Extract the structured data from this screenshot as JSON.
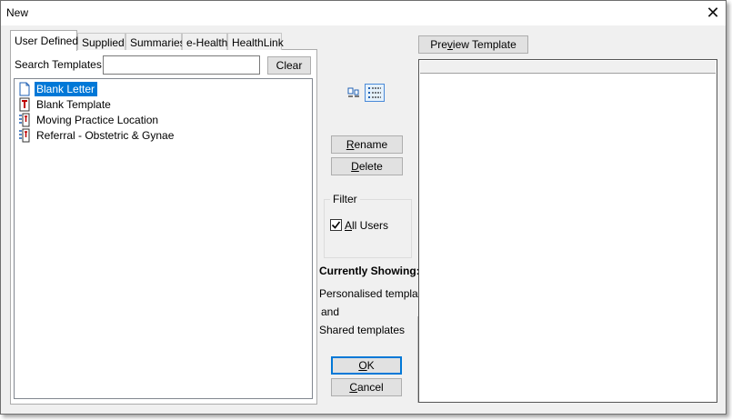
{
  "window": {
    "title": "New",
    "close_glyph": "✕"
  },
  "tabs": [
    {
      "label": "User Defined",
      "active": true
    },
    {
      "label": "Supplied"
    },
    {
      "label": "Summaries"
    },
    {
      "label": "e-Health"
    },
    {
      "label": "HealthLink"
    }
  ],
  "search": {
    "label": "Search Templates:",
    "value": "",
    "placeholder": "",
    "clear_label": "Clear"
  },
  "templates": [
    {
      "label": "Blank Letter",
      "icon": "document-icon",
      "selected": true
    },
    {
      "label": "Blank Template",
      "icon": "template-icon"
    },
    {
      "label": "Moving Practice Location",
      "icon": "shared-template-icon"
    },
    {
      "label": "Referral - Obstetric & Gynae",
      "icon": "shared-template-icon"
    }
  ],
  "view_modes": {
    "list_icon": "list-view-icon",
    "details_icon": "details-view-icon"
  },
  "actions": {
    "rename_prefix": "R",
    "rename_rest": "ename",
    "delete_prefix": "D",
    "delete_rest": "elete"
  },
  "filter": {
    "legend": "Filter",
    "all_users_prefix": "A",
    "all_users_rest": "ll Users",
    "all_users_checked": true
  },
  "status": {
    "heading": "Currently Showing:",
    "line1": "Personalised templates",
    "line2": "and",
    "line3": "Shared templates"
  },
  "preview": {
    "button_prefix": "Pre",
    "button_ul": "v",
    "button_rest": "iew Template"
  },
  "footer": {
    "ok_label": "OK",
    "ok_ul": "O",
    "ok_rest": "K",
    "cancel_ul": "C",
    "cancel_rest": "ancel"
  },
  "colors": {
    "selection": "#0078d7",
    "default_button_border": "#0078d7",
    "dialog_bg": "#f0f0f0"
  }
}
